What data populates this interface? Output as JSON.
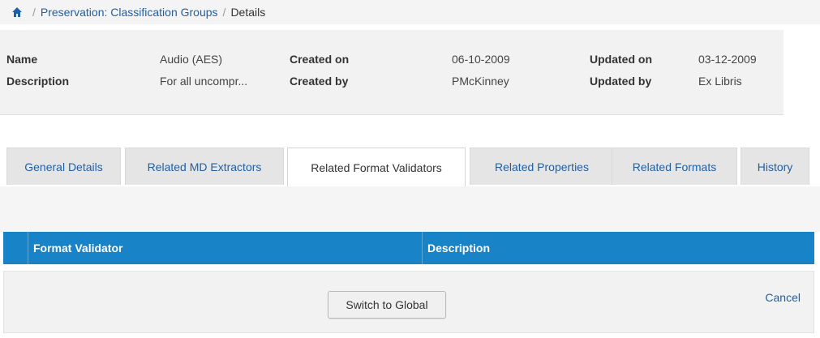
{
  "breadcrumb": {
    "home_icon": "home-icon",
    "separator": "/",
    "parent": "Preservation: Classification Groups",
    "current": "Details"
  },
  "summary": {
    "name_label": "Name",
    "name_value": "Audio (AES)",
    "description_label": "Description",
    "description_value": "For all uncompr...",
    "created_on_label": "Created on",
    "created_on_value": "06-10-2009",
    "created_by_label": "Created by",
    "created_by_value": "PMcKinney",
    "updated_on_label": "Updated on",
    "updated_on_value": "03-12-2009",
    "updated_by_label": "Updated by",
    "updated_by_value": "Ex Libris"
  },
  "tabs": [
    {
      "label": "General Details"
    },
    {
      "label": "Related MD Extractors"
    },
    {
      "label": "Related Format Validators",
      "active": true
    },
    {
      "label": "Related Properties"
    },
    {
      "label": "Related Formats"
    },
    {
      "label": "History"
    }
  ],
  "table": {
    "columns": [
      "Format Validator",
      "Description"
    ]
  },
  "footer": {
    "switch_label": "Switch to Global",
    "cancel_label": "Cancel"
  },
  "colors": {
    "link": "#1f5fa6",
    "table_header": "#1884c7"
  }
}
